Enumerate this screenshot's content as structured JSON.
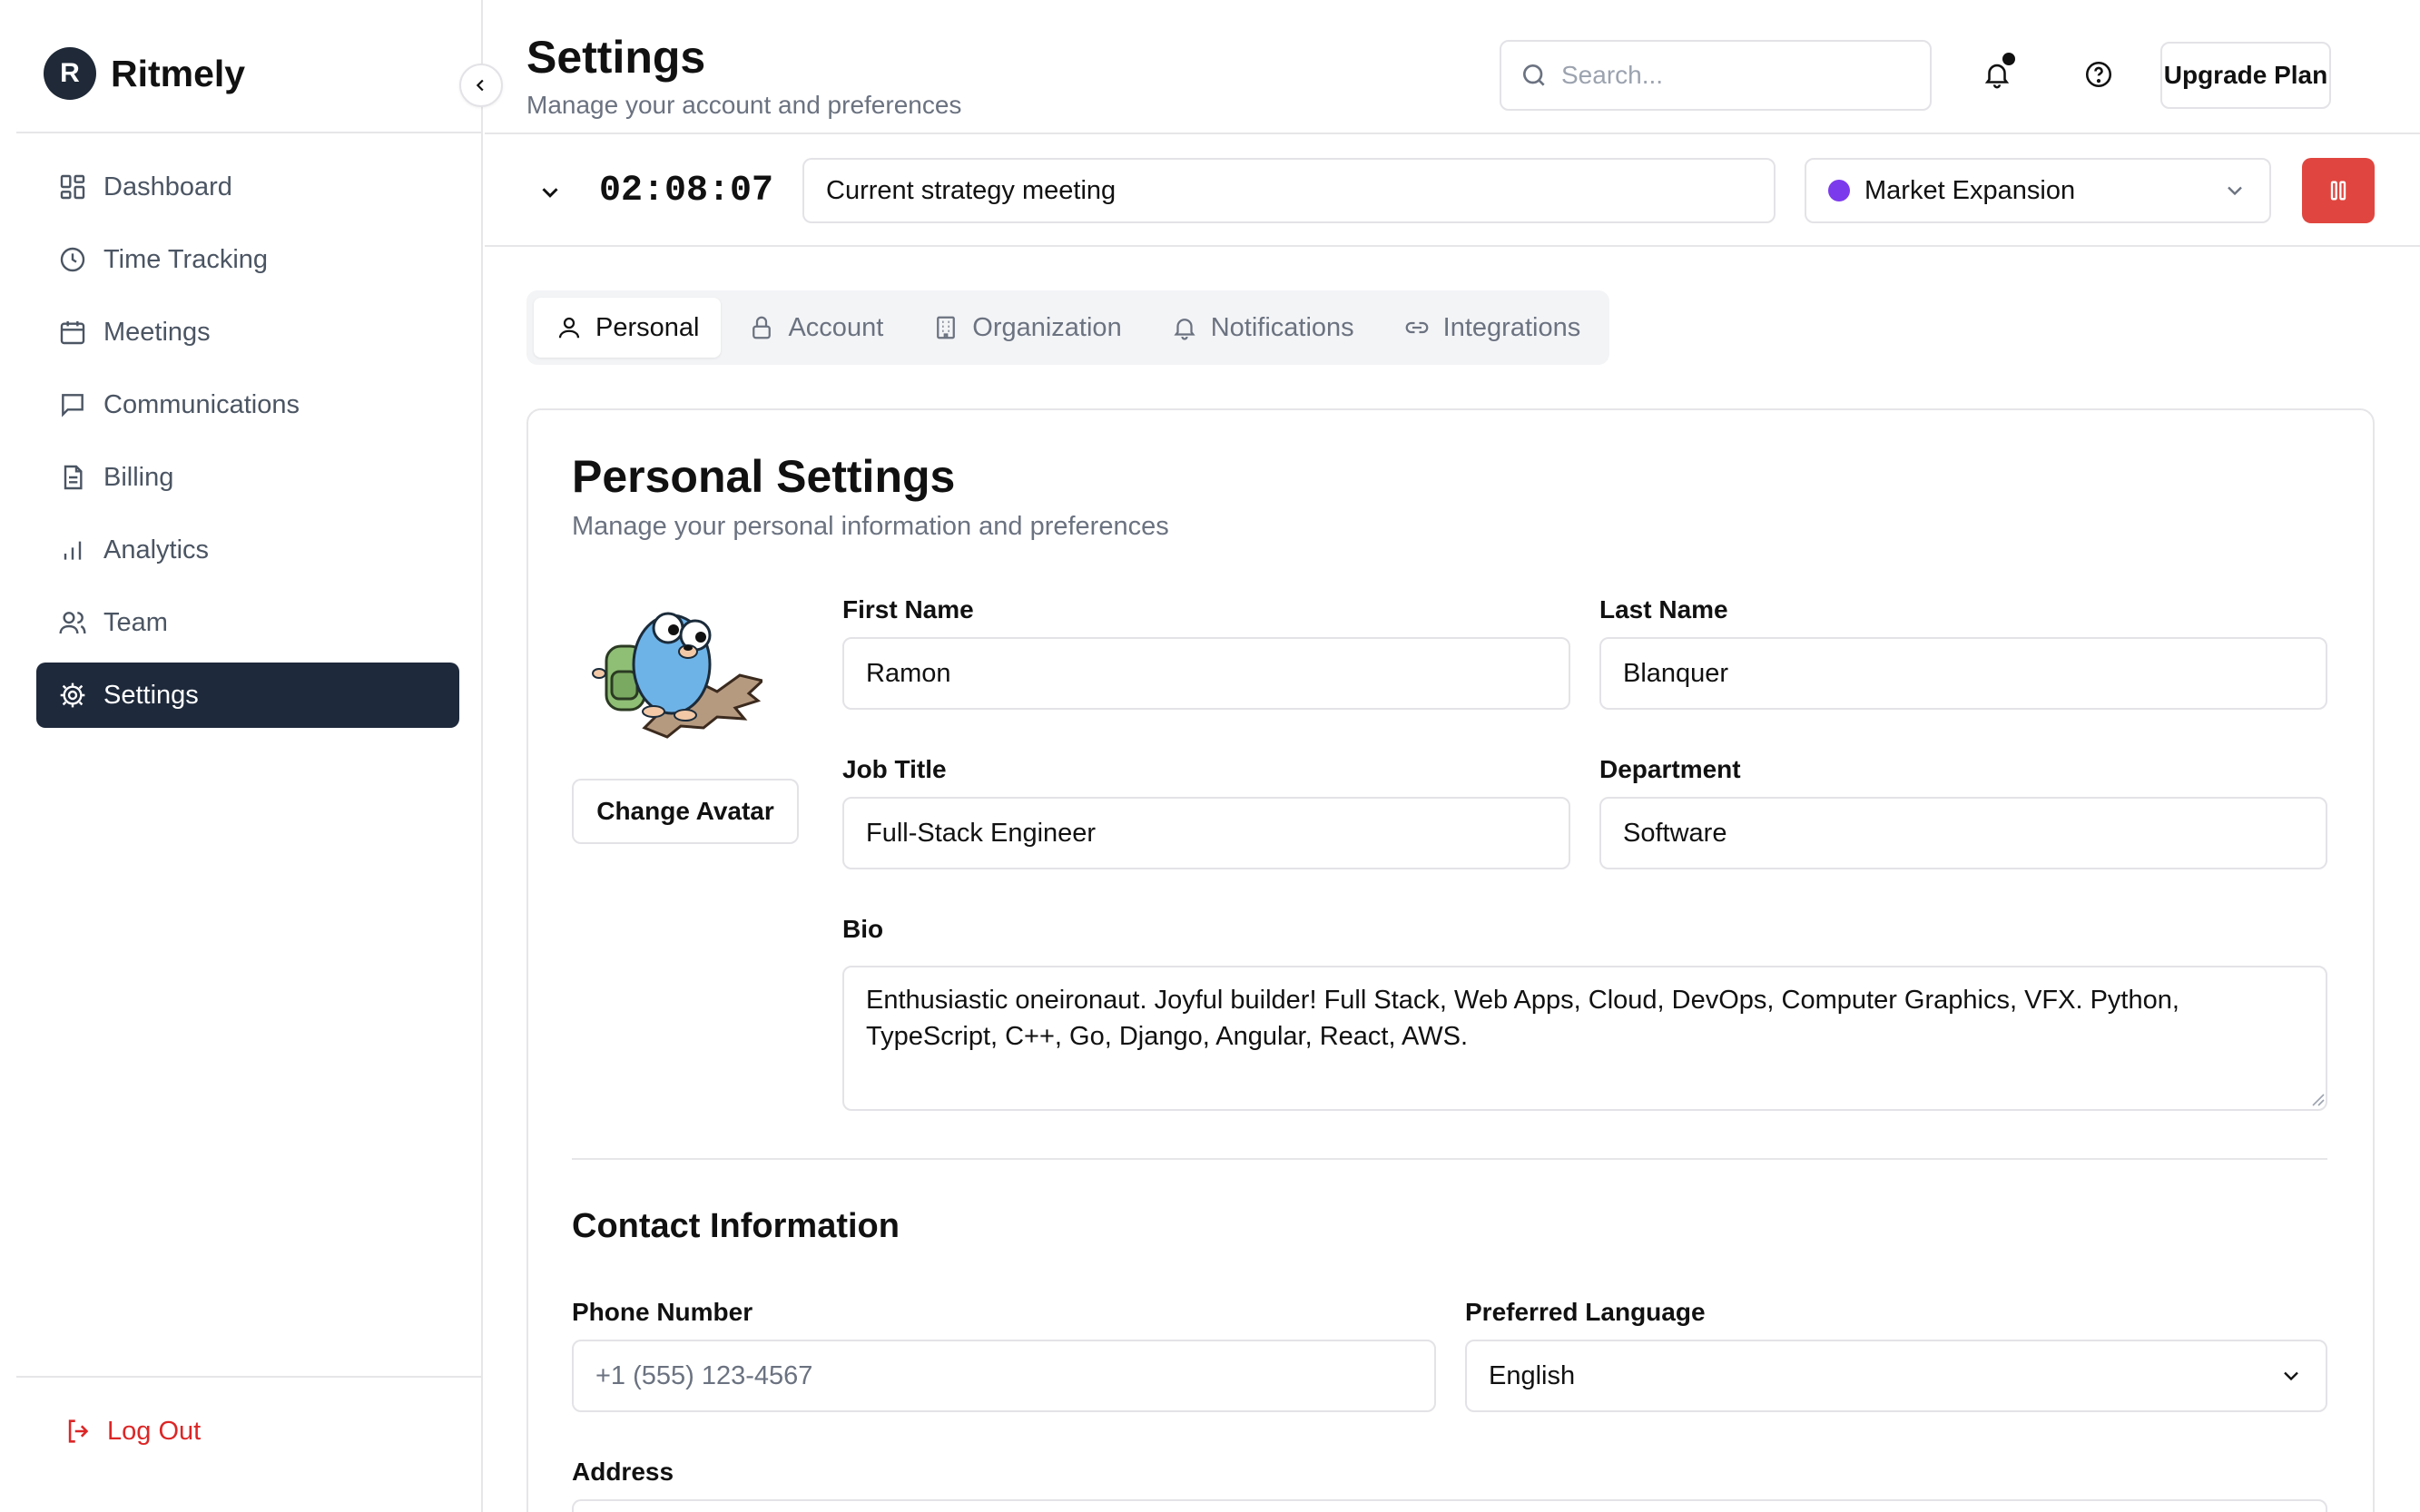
{
  "app": {
    "logo_letter": "R",
    "name": "Ritmely"
  },
  "sidebar": {
    "items": [
      {
        "label": "Dashboard",
        "icon": "dashboard-icon",
        "active": false
      },
      {
        "label": "Time Tracking",
        "icon": "clock-icon",
        "active": false
      },
      {
        "label": "Meetings",
        "icon": "calendar-icon",
        "active": false
      },
      {
        "label": "Communications",
        "icon": "message-icon",
        "active": false
      },
      {
        "label": "Billing",
        "icon": "file-text-icon",
        "active": false
      },
      {
        "label": "Analytics",
        "icon": "bar-chart-icon",
        "active": false
      },
      {
        "label": "Team",
        "icon": "users-icon",
        "active": false
      },
      {
        "label": "Settings",
        "icon": "gear-icon",
        "active": true
      }
    ],
    "logout_label": "Log Out"
  },
  "header": {
    "title": "Settings",
    "subtitle": "Manage your account and preferences",
    "search_placeholder": "Search...",
    "upgrade_label": "Upgrade Plan"
  },
  "timer": {
    "elapsed": "02:08:07",
    "task": "Current strategy meeting",
    "project": "Market Expansion",
    "project_color": "#7c3aed",
    "stop_color": "#e0463f"
  },
  "tabs": [
    {
      "label": "Personal",
      "icon": "user-icon",
      "active": true
    },
    {
      "label": "Account",
      "icon": "lock-icon",
      "active": false
    },
    {
      "label": "Organization",
      "icon": "building-icon",
      "active": false
    },
    {
      "label": "Notifications",
      "icon": "bell-icon",
      "active": false
    },
    {
      "label": "Integrations",
      "icon": "link-icon",
      "active": false
    }
  ],
  "personal": {
    "title": "Personal Settings",
    "subtitle": "Manage your personal information and preferences",
    "change_avatar_label": "Change Avatar",
    "fields": {
      "first_name": {
        "label": "First Name",
        "value": "Ramon"
      },
      "last_name": {
        "label": "Last Name",
        "value": "Blanquer"
      },
      "job_title": {
        "label": "Job Title",
        "value": "Full-Stack Engineer"
      },
      "department": {
        "label": "Department",
        "value": "Software"
      },
      "bio": {
        "label": "Bio",
        "value": "Enthusiastic oneironaut. Joyful builder! Full Stack, Web Apps, Cloud, DevOps, Computer Graphics, VFX. Python, TypeScript, C++, Go, Django, Angular, React, AWS."
      }
    }
  },
  "contact": {
    "title": "Contact Information",
    "phone": {
      "label": "Phone Number",
      "placeholder": "+1 (555) 123-4567"
    },
    "language": {
      "label": "Preferred Language",
      "value": "English"
    },
    "address_label": "Address"
  }
}
